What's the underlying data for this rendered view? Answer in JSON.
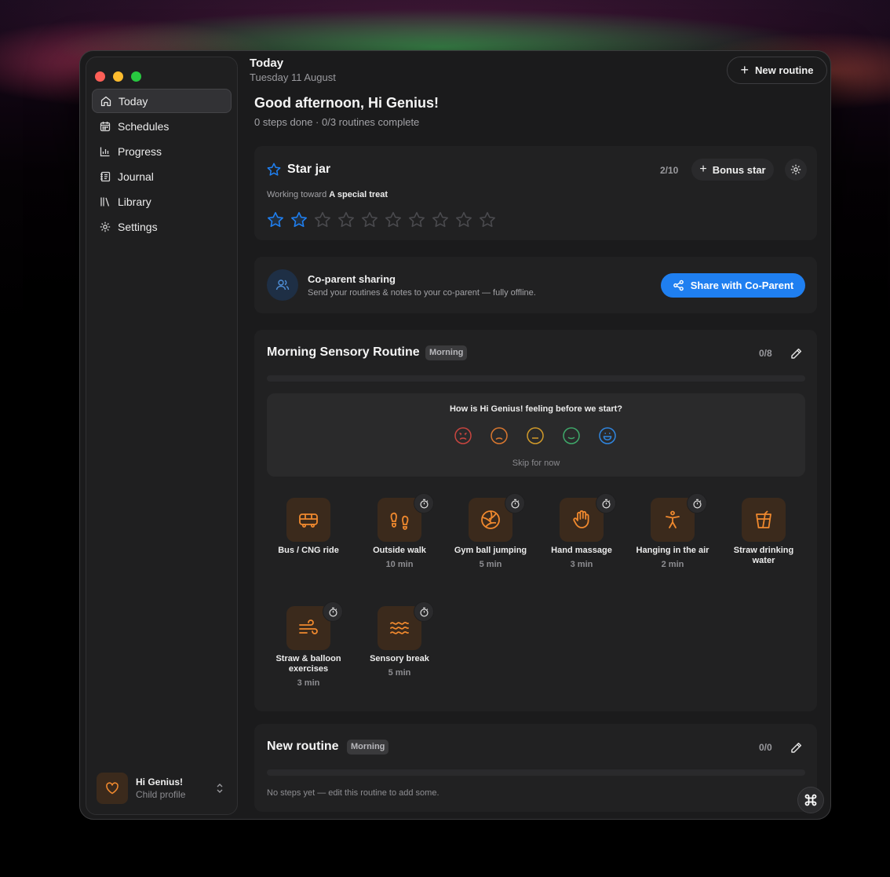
{
  "colors": {
    "accent_blue": "#1f7ff0",
    "star_filled": "#1f7ff0",
    "star_empty": "#4a4a4e",
    "tile_icon": "#f0892e",
    "tile_bg": "#3b2a1c"
  },
  "sidebar": {
    "items": [
      {
        "label": "Today",
        "icon": "home-icon",
        "active": true
      },
      {
        "label": "Schedules",
        "icon": "calendar-icon"
      },
      {
        "label": "Progress",
        "icon": "bar-chart-icon"
      },
      {
        "label": "Journal",
        "icon": "journal-icon"
      },
      {
        "label": "Library",
        "icon": "library-icon"
      },
      {
        "label": "Settings",
        "icon": "gear-icon"
      }
    ],
    "profile": {
      "name": "Hi Genius!",
      "subtitle": "Child profile"
    }
  },
  "header": {
    "title": "Today",
    "date": "Tuesday 11 August",
    "new_routine_label": "New routine"
  },
  "greeting": {
    "title": "Good afternoon, Hi Genius!",
    "summary": "0 steps done · 0/3 routines complete"
  },
  "star_jar": {
    "title": "Star jar",
    "count": "2/10",
    "filled": 2,
    "total": 10,
    "bonus_label": "Bonus star",
    "working_prefix": "Working toward",
    "goal": "A special treat"
  },
  "coparent": {
    "title": "Co-parent sharing",
    "subtitle": "Send your routines & notes to your co-parent — fully offline.",
    "button_label": "Share with Co-Parent"
  },
  "routine": {
    "title": "Morning Sensory Routine",
    "badge": "Morning",
    "count": "0/8",
    "feeling_question": "How is Hi Genius! feeling before we start?",
    "moods": [
      "angry-face-icon",
      "sad-face-icon",
      "neutral-face-icon",
      "smile-face-icon",
      "happy-face-icon"
    ],
    "skip_label": "Skip for now",
    "steps": [
      {
        "name": "Bus / CNG ride",
        "duration": "",
        "icon": "bus-icon",
        "timer": false
      },
      {
        "name": "Outside walk",
        "duration": "10 min",
        "icon": "footprints-icon",
        "timer": true
      },
      {
        "name": "Gym ball jumping",
        "duration": "5 min",
        "icon": "ball-icon",
        "timer": true
      },
      {
        "name": "Hand massage",
        "duration": "3 min",
        "icon": "hand-icon",
        "timer": true
      },
      {
        "name": "Hanging in the air",
        "duration": "2 min",
        "icon": "person-icon",
        "timer": true
      },
      {
        "name": "Straw drinking water",
        "duration": "",
        "icon": "cup-straw-icon",
        "timer": false
      },
      {
        "name": "Straw & balloon exercises",
        "duration": "3 min",
        "icon": "wind-icon",
        "timer": true
      },
      {
        "name": "Sensory break",
        "duration": "5 min",
        "icon": "waves-icon",
        "timer": true
      }
    ]
  },
  "new_routine": {
    "title": "New routine",
    "badge": "Morning",
    "count": "0/0",
    "empty_text": "No steps yet — edit this routine to add some."
  }
}
